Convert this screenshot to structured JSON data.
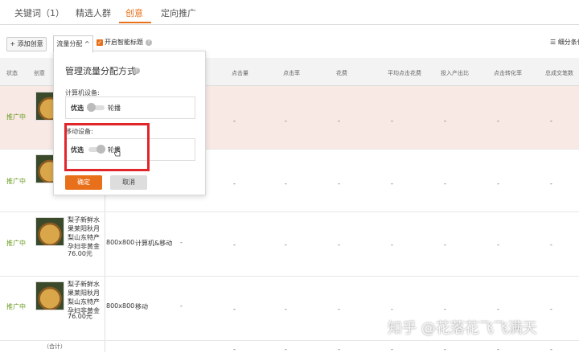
{
  "tabs": [
    {
      "label": "关键词（1）",
      "active": false
    },
    {
      "label": "精选人群",
      "active": false
    },
    {
      "label": "创意",
      "active": true
    },
    {
      "label": "定向推广",
      "active": false
    }
  ],
  "toolbar": {
    "add_label": "+ 添加创意",
    "flow_label": "流量分配 ^",
    "smart_title_label": "开启智能标题",
    "subdivide_label": "细分条件"
  },
  "table_headers": [
    "状态",
    "创意",
    "点击量",
    "点击率",
    "花费",
    "平均点击花费",
    "投入产出比",
    "点击转化率",
    "总成交笔数"
  ],
  "rows": [
    {
      "status": "推广中",
      "title": "",
      "price": "",
      "size": "",
      "device": ""
    },
    {
      "status": "推广中",
      "title": "",
      "price": "",
      "size": "",
      "device": ""
    },
    {
      "status": "推广中",
      "title": "梨子新鲜水果莱阳秋月梨山东特产孕妇非黄金",
      "price": "76.00元",
      "size": "800x800",
      "device": "计算机&移动"
    },
    {
      "status": "推广中",
      "title": "梨子新鲜水果莱阳秋月梨山东特产孕妇非黄金",
      "price": "76.00元",
      "size": "800x800",
      "device": "移动"
    }
  ],
  "dash": "-",
  "total_label": "（合计）",
  "panel": {
    "title": "管理流量分配方式",
    "pc_label": "计算机设备:",
    "mobile_label": "移动设备:",
    "left_option": "优选",
    "right_option": "轮播",
    "ok_label": "确定",
    "cancel_label": "取消"
  },
  "watermark": "知乎 @花落花飞飞满天",
  "colors": {
    "accent": "#e8701a",
    "status": "#6a9b1e",
    "highlight": "#e0262b"
  }
}
